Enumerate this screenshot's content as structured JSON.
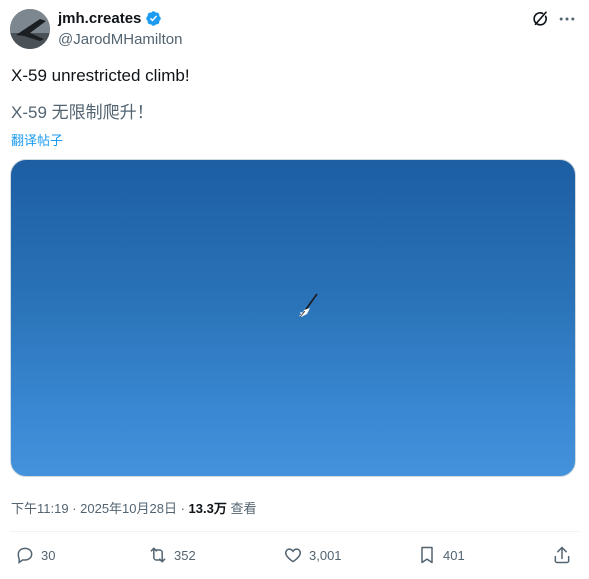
{
  "author": {
    "display_name": "jmh.creates",
    "handle": "@JarodMHamilton"
  },
  "tweet": {
    "text": "X-59 unrestricted climb!",
    "translated_text": "X-59 无限制爬升！",
    "translate_link": "翻译帖子"
  },
  "meta": {
    "time": "下午11:19",
    "sep1": " · ",
    "date": "2025年10月28日",
    "sep2": " · ",
    "views_count": "13.3万",
    "views_label": " 查看"
  },
  "actions": {
    "replies": "30",
    "reposts": "352",
    "likes": "3,001",
    "bookmarks": "401"
  },
  "colors": {
    "accent": "#1d9bf0",
    "secondary_text": "#536471",
    "primary_text": "#0f1419"
  },
  "icons": [
    "verified-badge-icon",
    "grok-icon",
    "more-icon",
    "reply-icon",
    "repost-icon",
    "like-icon",
    "bookmark-icon",
    "share-icon"
  ]
}
